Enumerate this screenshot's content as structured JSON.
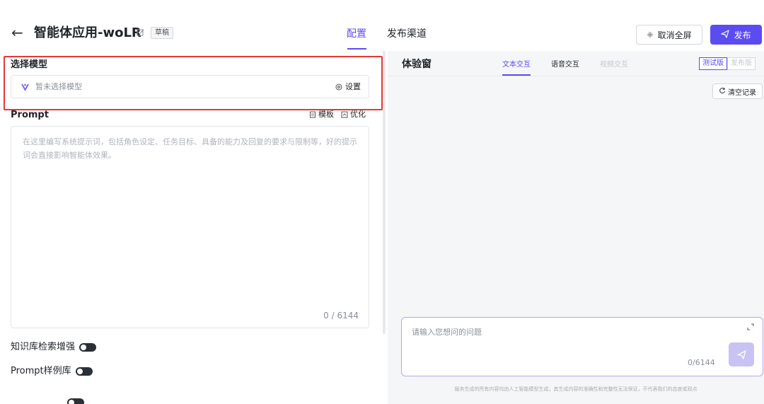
{
  "header": {
    "back_icon": "arrow-left-icon",
    "title": "智能体应用-woLR",
    "edit_icon": "edit-icon",
    "badge": "草稿",
    "tabs": [
      {
        "label": "配置",
        "active": true
      },
      {
        "label": "发布渠道",
        "active": false
      }
    ],
    "fullscreen_icon": "⁜",
    "fullscreen_label": "取消全屏",
    "publish_icon": "send-icon",
    "publish_label": "发布",
    "accent_color": "#5b4cf2"
  },
  "config": {
    "model_label": "选择模型",
    "model_placeholder": "暂未选择模型",
    "model_settings": "设置",
    "prompt_label": "Prompt",
    "prompt_tools": {
      "template": "模板",
      "optimize": "优化"
    },
    "prompt_placeholder": "在这里编写系统提示词，包括角色设定、任务目标、具备的能力及回复的要求与限制等，好的提示词会直接影响智能体效果。",
    "prompt_count": "0 / 6144",
    "toggles": [
      {
        "label": "知识库检索增强",
        "on": false
      },
      {
        "label": "Prompt样例库",
        "on": false
      }
    ],
    "highlight_color": "#e53935"
  },
  "experience": {
    "title": "体验窗",
    "modes": [
      {
        "label": "文本交互",
        "state": "active"
      },
      {
        "label": "语音交互",
        "state": "normal"
      },
      {
        "label": "视频交互",
        "state": "disabled"
      }
    ],
    "versions": [
      {
        "label": "测试版",
        "active": true
      },
      {
        "label": "发布版",
        "active": false
      }
    ],
    "clear_label": "清空记录",
    "input_placeholder": "请输入您想问的问题",
    "input_count": "0/6144",
    "disclaimer": "服务生成的所有内容均由人工智能模型生成，其生成内容的准确性和完整性无法保证，不代表我们的态度或观点"
  }
}
